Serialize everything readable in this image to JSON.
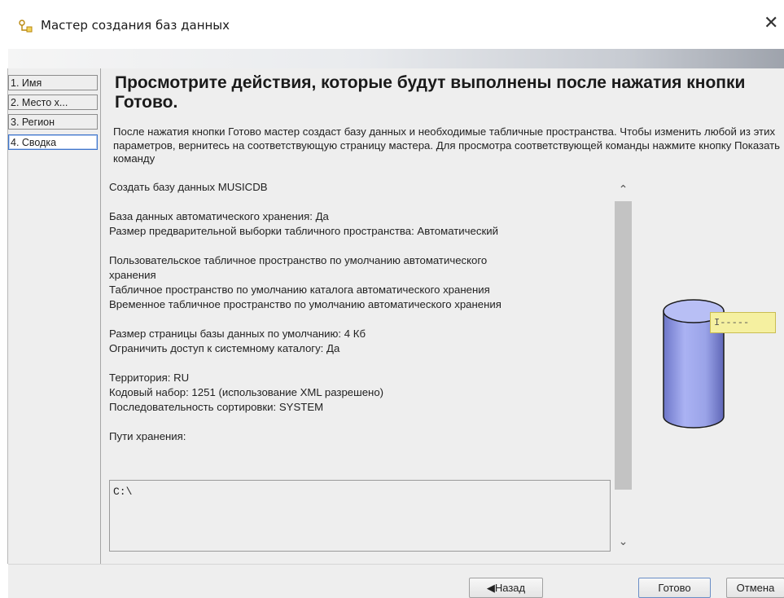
{
  "window": {
    "title": "Мастер создания баз данных",
    "close_glyph": "✕",
    "icon": "db-wizard-icon"
  },
  "sidebar": {
    "items": [
      {
        "label": "1. Имя"
      },
      {
        "label": "2. Место х..."
      },
      {
        "label": "3. Регион"
      },
      {
        "label": "4. Сводка",
        "active": true
      }
    ]
  },
  "main": {
    "heading": "Просмотрите действия, которые будут выполнены после нажатия кнопки Готово.",
    "description": "После нажатия кнопки Готово мастер создаст базу данных и необходимые табличные пространства. Чтобы изменить любой из этих параметров, вернитесь на соответствующую страницу мастера. Для просмотра соответствующей команды нажмите кнопку Показать команду",
    "summary": {
      "create": "Создать базу данных MUSICDB",
      "auto_storage": "База данных автоматического хранения: Да",
      "prefetch": "Размер предварительной выборки табличного пространства: Автоматический",
      "user_ts_1": "Пользовательское табличное пространство по умолчанию автоматического",
      "user_ts_2": "хранения",
      "catalog_ts": "Табличное пространство по умолчанию каталога автоматического хранения",
      "temp_ts": "Временное табличное пространство по умолчанию автоматического хранения",
      "page_size": "Размер страницы базы данных по умолчанию: 4 Кб",
      "restrict": "Ограничить доступ к системному каталогу: Да",
      "territory": "Территория: RU",
      "codeset": "Кодовый набор: 1251 (использование XML разрешено)",
      "collation": "Последовательность сортировки: SYSTEM",
      "paths_label": "Пути хранения:"
    },
    "paths_value": "C:\\",
    "tooltip_text": "I-----"
  },
  "scrollbar": {
    "up_glyph": "⌃",
    "down_glyph": "⌄"
  },
  "buttons": {
    "back": "◀Назад",
    "finish": "Готово",
    "cancel": "Отмена"
  },
  "colors": {
    "active_border": "#3e74c9",
    "cylinder": "#9aa3e8",
    "tooltip_bg": "#f5f0a0"
  }
}
